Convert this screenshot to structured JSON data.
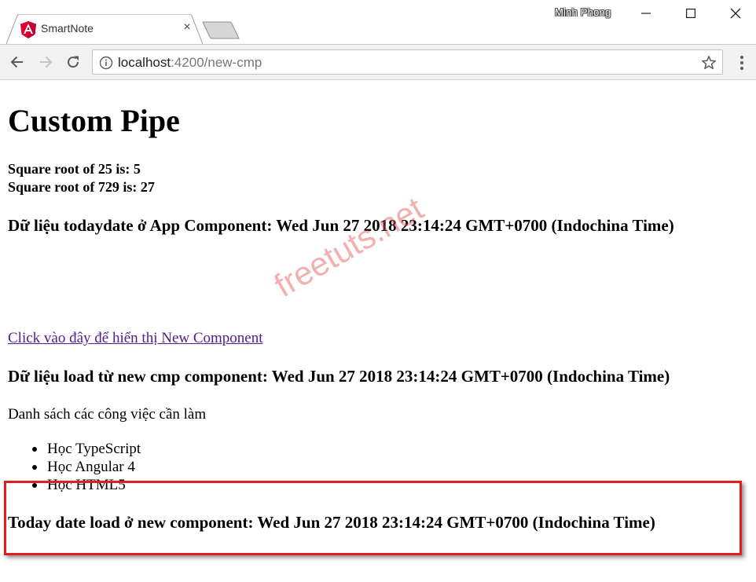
{
  "browser": {
    "tab_title": "SmartNote",
    "tab_close": "×",
    "profile_name": "Minh Phong",
    "url_host": "localhost",
    "url_rest": ":4200/new-cmp",
    "icons": {
      "favicon": "angular-logo-icon",
      "close_tab": "close-icon",
      "new_tab": "new-tab-icon",
      "minimize": "minimize-icon",
      "maximize": "maximize-icon",
      "close_window": "close-icon",
      "back": "arrow-left-icon",
      "forward": "arrow-right-icon",
      "reload": "reload-icon",
      "info": "info-icon",
      "bookmark": "star-icon",
      "menu": "kebab-menu-icon"
    },
    "colors": {
      "angular_red": "#dd0031",
      "link_visited": "#551a8b",
      "highlight": "#e02020"
    }
  },
  "page": {
    "title": "Custom Pipe",
    "sqrt_line_1": "Square root of 25 is: 5",
    "sqrt_line_2": "Square root of 729 is: 27",
    "app_component_heading": "Dữ liệu todaydate ở App Component: Wed Jun 27 2018 23:14:24 GMT+0700 (Indochina Time)",
    "nav_link": "Click vào đây để hiển thị New Component",
    "new_cmp_heading": "Dữ liệu load từ new cmp component: Wed Jun 27 2018 23:14:24 GMT+0700 (Indochina Time)",
    "todo_title": "Danh sách các công việc cần làm",
    "todo_items": [
      "Học TypeScript",
      "Học Angular 4",
      "Học HTML5"
    ],
    "today_heading": "Today date load ở new component: Wed Jun 27 2018 23:14:24 GMT+0700 (Indochina Time)",
    "watermark": "freetuts.net"
  }
}
